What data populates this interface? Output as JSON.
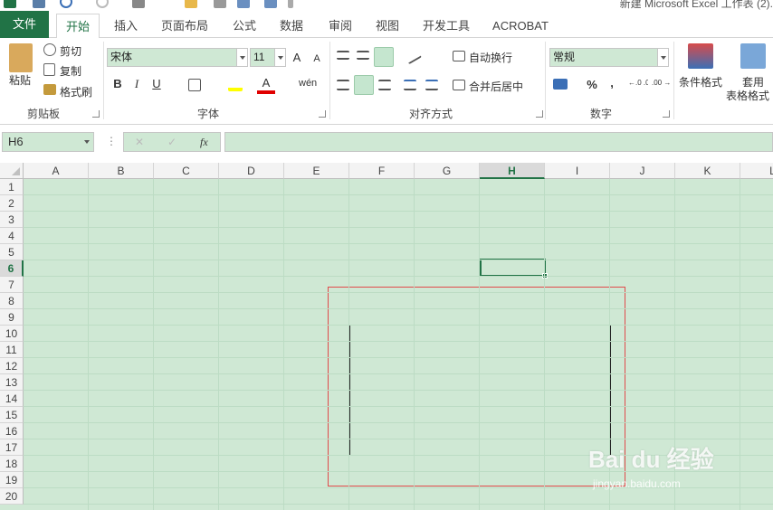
{
  "title_bar": {
    "title": "新建 Microsoft Excel 工作表 (2)."
  },
  "tabs": [
    {
      "label": "文件"
    },
    {
      "label": "开始"
    },
    {
      "label": "插入"
    },
    {
      "label": "页面布局"
    },
    {
      "label": "公式"
    },
    {
      "label": "数据"
    },
    {
      "label": "审阅"
    },
    {
      "label": "视图"
    },
    {
      "label": "开发工具"
    },
    {
      "label": "ACROBAT"
    }
  ],
  "ribbon": {
    "clipboard": {
      "paste": "粘贴",
      "cut": "剪切",
      "copy": "复制",
      "format_painter": "格式刷",
      "group": "剪贴板"
    },
    "font": {
      "name": "宋体",
      "size": "11",
      "bold": "B",
      "italic": "I",
      "underline": "U",
      "font_color_label": "A",
      "phonetic": "wén",
      "grow": "A",
      "shrink": "A",
      "group": "字体"
    },
    "alignment": {
      "wrap_text": "自动换行",
      "merge_center": "合并后居中",
      "group": "对齐方式"
    },
    "number": {
      "format": "常规",
      "percent": "%",
      "comma": ",",
      "inc_decimal": "←.0 .00",
      "dec_decimal": ".00 →.0",
      "group": "数字"
    },
    "styles": {
      "conditional": "条件格式",
      "format_as_table_1": "套用",
      "format_as_table_2": "表格格式"
    }
  },
  "formula_bar": {
    "name_box": "H6",
    "fx": "fx",
    "cancel": "✕",
    "enter": "✓",
    "more": "⋮"
  },
  "sheet": {
    "columns": [
      "A",
      "B",
      "C",
      "D",
      "E",
      "F",
      "G",
      "H",
      "I",
      "J",
      "K",
      "L"
    ],
    "rows": [
      "1",
      "2",
      "3",
      "4",
      "5",
      "6",
      "7",
      "8",
      "9",
      "10",
      "11",
      "12",
      "13",
      "14",
      "15",
      "16",
      "17",
      "18",
      "19",
      "20"
    ],
    "selected_cell": "H6"
  },
  "watermark": {
    "brand": "Bai du 经验",
    "sub": "jingyan.baidu.com"
  },
  "colors": {
    "excel_green": "#217346",
    "sheet_bg": "#cfe8d4",
    "red_outline": "#e04b4b"
  }
}
